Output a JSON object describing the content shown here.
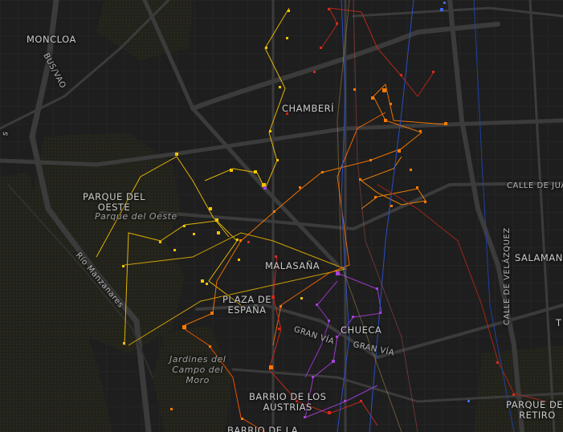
{
  "map": {
    "neighborhoods": {
      "moncloa": "MONCLOA",
      "chamberi": "CHAMBERÍ",
      "parque_del_oeste": [
        "PARQUE DEL",
        "OESTE"
      ],
      "malasana": "MALASAÑA",
      "plaza_de_espana": [
        "PLAZA DE",
        "ESPAÑA"
      ],
      "chueca": "CHUECA",
      "barrio_austrias": [
        "BARRIO DE LOS",
        "AUSTRIAS"
      ],
      "salamanca": "SALAMANC",
      "parque_retiro": [
        "PARQUE DEL",
        "RETIRO"
      ],
      "barrio_bottom": "BARRIO DE LA"
    },
    "parks": {
      "parque_del_oeste": "Parque del Oeste",
      "jardines": [
        "Jardines del",
        "Campo del",
        "Moro"
      ]
    },
    "streets": {
      "bus_vao": "BUS/VAO",
      "rio_manzanares": "Río Manzanares",
      "gran_via_1": "GRAN VÍA",
      "gran_via_2": "GRAN VÍA",
      "calle_de_juan": "CALLE DE JUA",
      "calle_velazquez": "CALLE DE VELÁZQUEZ",
      "edge_e": "s",
      "edge_t": "T"
    },
    "colors": {
      "background": "#1e1e1e",
      "park": "#262620",
      "road": "#3a3a3a",
      "yellow": "#f5c400",
      "orange": "#ff7a00",
      "red": "#d62a1a",
      "purple": "#a640d8",
      "blue": "#2a55d6"
    }
  }
}
